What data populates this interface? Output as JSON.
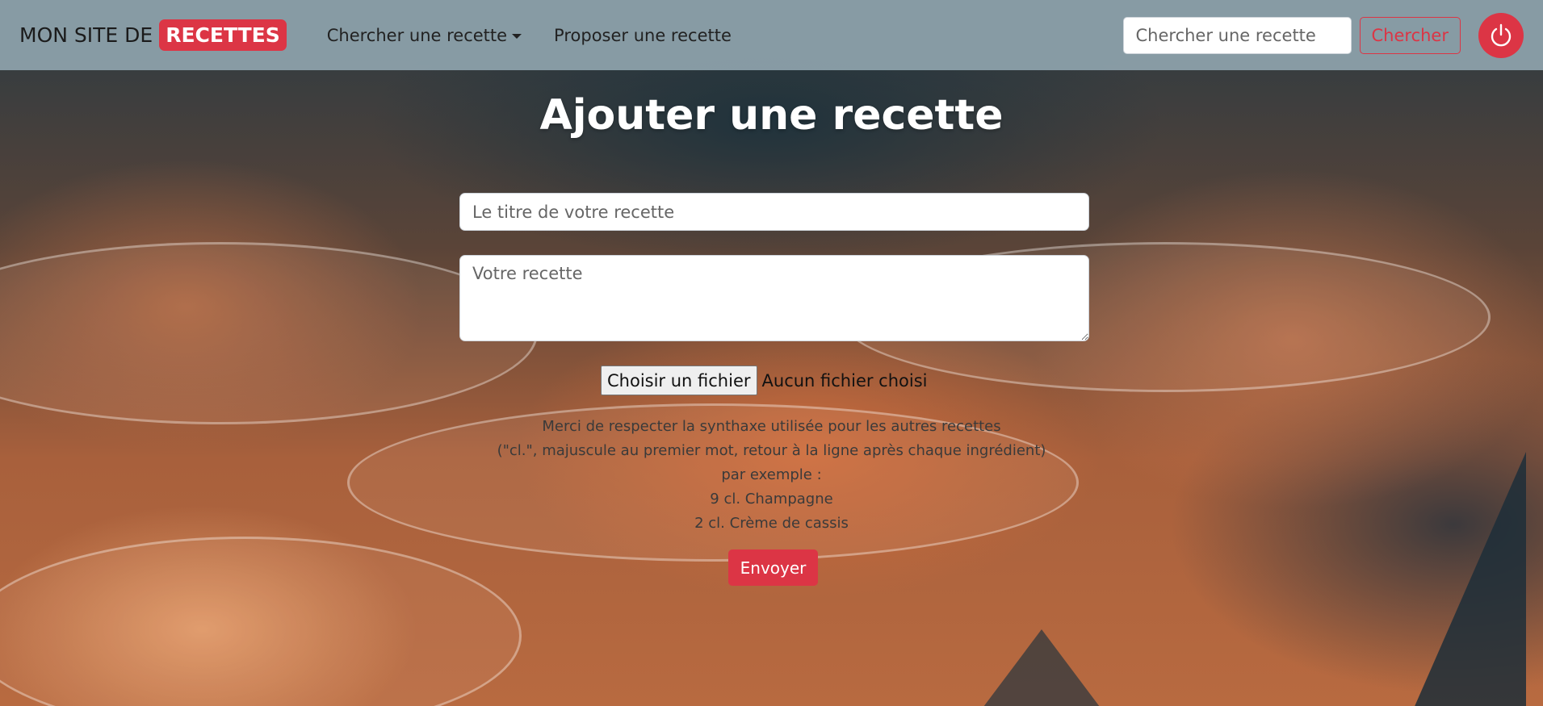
{
  "navbar": {
    "brand_text": "MON SITE DE",
    "brand_badge": "RECETTES",
    "links": [
      {
        "label": "Chercher une recette"
      },
      {
        "label": "Proposer une recette"
      }
    ],
    "search": {
      "placeholder": "Chercher une recette",
      "value": ""
    },
    "search_button": "Chercher",
    "power_icon": "power-icon"
  },
  "main": {
    "title": "Ajouter une recette",
    "title_input": {
      "placeholder": "Le titre de votre recette",
      "value": ""
    },
    "recipe_textarea": {
      "placeholder": "Votre recette",
      "value": ""
    },
    "file_button": "Choisir un fichier",
    "file_status": "Aucun fichier choisi",
    "help_lines": [
      "Merci de respecter la synthaxe utilisée pour les autres recettes",
      "(\"cl.\", majuscule au premier mot, retour à la ligne après chaque ingrédient)",
      "par exemple :",
      "9 cl. Champagne",
      "2 cl. Crème de cassis"
    ],
    "submit_button": "Envoyer"
  },
  "colors": {
    "accent": "#dc3545",
    "navbar_bg": "#8ca0aa"
  }
}
